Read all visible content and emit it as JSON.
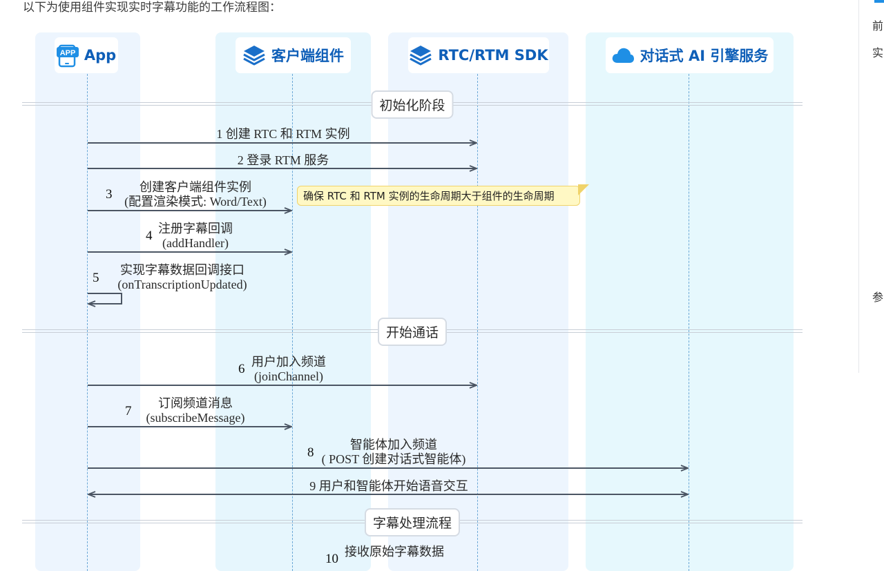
{
  "intro_text": "以下为使用组件实现实时字幕功能的工作流程图：",
  "lanes": [
    {
      "label": "App",
      "icon": "app-icon"
    },
    {
      "label": "客户端组件",
      "icon": "layers-icon"
    },
    {
      "label": "RTC/RTM SDK",
      "icon": "layers-icon"
    },
    {
      "label": "对话式 AI 引擎服务",
      "icon": "cloud-icon"
    }
  ],
  "sections": [
    "初始化阶段",
    "开始通话",
    "字幕处理流程"
  ],
  "steps": [
    {
      "num": "1",
      "lines": [
        "创建 RTC 和 RTM 实例"
      ]
    },
    {
      "num": "2",
      "lines": [
        "登录 RTM 服务"
      ]
    },
    {
      "num": "3",
      "lines": [
        "创建客户端组件实例",
        "(配置渲染模式: Word/Text)"
      ]
    },
    {
      "num": "4",
      "lines": [
        "注册字幕回调",
        "(addHandler)"
      ]
    },
    {
      "num": "5",
      "lines": [
        "实现字幕数据回调接口",
        "(onTranscriptionUpdated)"
      ]
    },
    {
      "num": "6",
      "lines": [
        "用户加入频道",
        "(joinChannel)"
      ]
    },
    {
      "num": "7",
      "lines": [
        "订阅频道消息",
        "(subscribeMessage)"
      ]
    },
    {
      "num": "8",
      "lines": [
        "智能体加入频道",
        "( POST 创建对话式智能体)"
      ]
    },
    {
      "num": "9",
      "lines": [
        "用户和智能体开始语音交互"
      ]
    },
    {
      "num": "10",
      "lines": [
        "接收原始字幕数据"
      ]
    }
  ],
  "note": "确保 RTC 和 RTM 实例的生命周期大于组件的生命周期",
  "sidebar_chars": [
    "前",
    "实",
    "参"
  ],
  "app_icon_text": "APP",
  "colors": {
    "lane_header_text": "#0f5fb8",
    "lane_app_bg": "#edf5fe",
    "lane_component_bg": "#e6f6fd",
    "lane_sdk_bg": "#edf5fe",
    "lane_service_bg": "#e6f8fd",
    "arrow": "#4b5563",
    "lifeline": "#6aa7d6",
    "note_bg": "#fff8c4"
  }
}
